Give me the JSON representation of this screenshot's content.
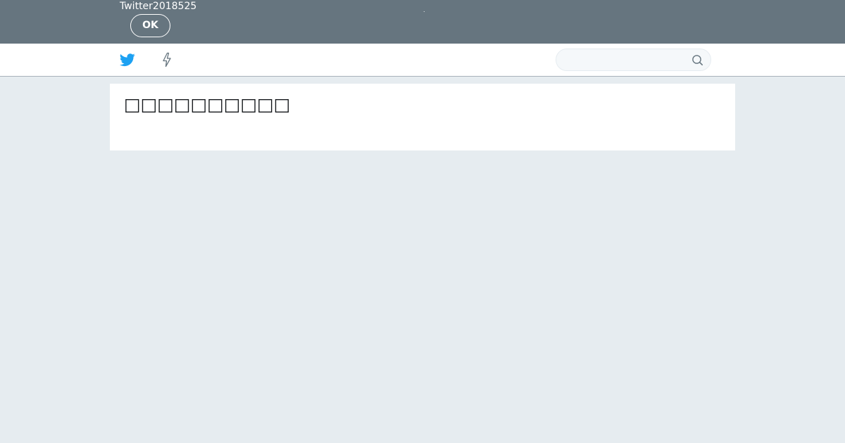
{
  "notice": {
    "text": "Twitter2018525",
    "dot": ".",
    "ok_label": "OK"
  },
  "topnav": {
    "logo_icon": "twitter-bird-icon",
    "moments_icon": "lightning-bolt-icon",
    "search": {
      "placeholder": "",
      "value": "",
      "icon": "search-icon"
    }
  },
  "main": {
    "heading": "□□□□□□□□□□"
  },
  "colors": {
    "notice_bg": "#66757f",
    "brand_blue": "#1da1f2",
    "page_bg": "#e6ecf0",
    "icon_gray": "#66757f"
  }
}
